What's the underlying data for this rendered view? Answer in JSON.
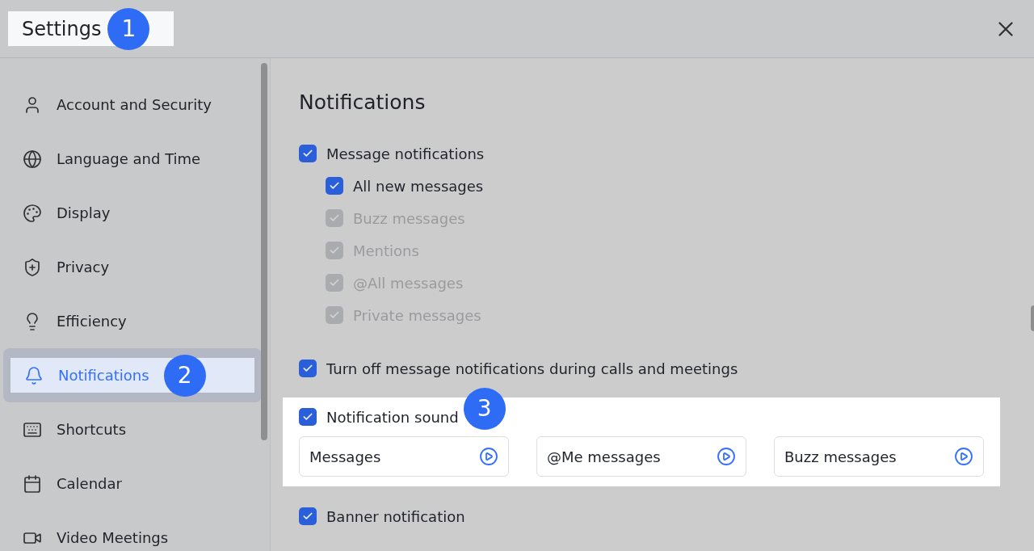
{
  "window": {
    "title": "Settings",
    "title_step": "1"
  },
  "sidebar": {
    "items": [
      {
        "label": "Account and Security",
        "selected": false
      },
      {
        "label": "Language and Time",
        "selected": false
      },
      {
        "label": "Display",
        "selected": false
      },
      {
        "label": "Privacy",
        "selected": false
      },
      {
        "label": "Efficiency",
        "selected": false
      },
      {
        "label": "Notifications",
        "selected": true,
        "step": "2"
      },
      {
        "label": "Shortcuts",
        "selected": false
      },
      {
        "label": "Calendar",
        "selected": false
      },
      {
        "label": "Video Meetings",
        "selected": false
      }
    ]
  },
  "content": {
    "heading": "Notifications",
    "options": [
      {
        "label": "Message notifications",
        "checked": true,
        "disabled": false,
        "children": [
          {
            "label": "All new messages",
            "checked": true,
            "disabled": false
          },
          {
            "label": "Buzz messages",
            "checked": true,
            "disabled": true
          },
          {
            "label": "Mentions",
            "checked": true,
            "disabled": true
          },
          {
            "label": "@All messages",
            "checked": true,
            "disabled": true
          },
          {
            "label": "Private messages",
            "checked": true,
            "disabled": true
          }
        ]
      },
      {
        "label": "Turn off message notifications during calls and meetings",
        "checked": true,
        "disabled": false
      }
    ],
    "sound": {
      "label": "Notification sound",
      "checked": true,
      "step": "3",
      "sounds": [
        "Messages",
        "@Me messages",
        "Buzz messages"
      ]
    },
    "banner": {
      "label": "Banner notification",
      "checked": true
    }
  }
}
